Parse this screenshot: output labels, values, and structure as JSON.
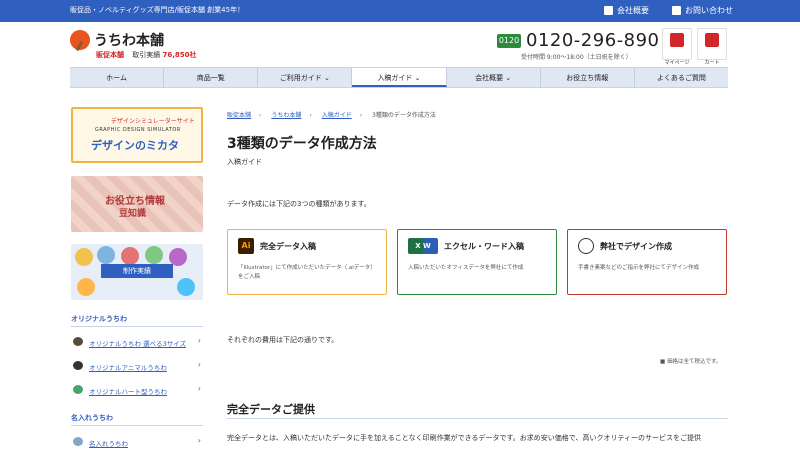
{
  "topbar": {
    "tagline": "販促品・ノベルティグッズ専門店/販促本舗 創業45年！",
    "company_link": "会社概要",
    "contact_link": "お問い合わせ"
  },
  "header": {
    "logo_title": "うちわ本舗",
    "logo_brand": "販促本舗",
    "logo_record_label": "取引実績",
    "logo_record_count": "76,850社",
    "phone_label": "0120",
    "phone_number": "0120-296-890",
    "hours": "受付時間 9:00～18:00（土日祝を除く）",
    "mypage_label": "マイページ",
    "cart_label": "カート"
  },
  "nav": {
    "items": [
      {
        "label": "ホーム"
      },
      {
        "label": "商品一覧"
      },
      {
        "label": "ご利用ガイド ⌄"
      },
      {
        "label": "入稿ガイド ⌄"
      },
      {
        "label": "会社概要 ⌄"
      },
      {
        "label": "お役立ち情報"
      },
      {
        "label": "よくあるご質問"
      }
    ]
  },
  "sidebar": {
    "banner1": {
      "line1": "デザインシミュレーターサイト",
      "line2": "GRAPHIC DESIGN SIMULATOR",
      "line3": "デザインのミカタ"
    },
    "banner2": {
      "line1": "お役立ち情報",
      "line2": "豆知識"
    },
    "banner3": {
      "label": "制作実績"
    },
    "section1_title": "オリジナルうちわ",
    "section1_links": [
      {
        "label": "オリジナルうちわ 選べる3サイズ"
      },
      {
        "label": "オリジナルアニマルうちわ"
      },
      {
        "label": "オリジナルハート型うちわ"
      }
    ],
    "section2_title": "名入れうちわ",
    "section2_links": [
      {
        "label": "名入れうちわ"
      }
    ]
  },
  "main": {
    "breadcrumb": [
      "販促本舗",
      "うちわ本舗",
      "入稿ガイド",
      "3種類のデータ作成方法"
    ],
    "title": "3種類のデータ作成方法",
    "subtitle": "入稿ガイド",
    "intro": "データ作成には下記の3つの種類があります。",
    "cards": [
      {
        "icon_text": "Ai",
        "name": "完全データ入稿",
        "desc": "「Illustrator」にて作成いただいたデータ（.aiデータ）をご入稿",
        "color": "#f0b440"
      },
      {
        "icon_text": "X W",
        "name": "エクセル・ワード入稿",
        "desc": "入稿いただいたオフィスデータを弊社にて作成",
        "color": "#2c8a3c"
      },
      {
        "icon_text": "",
        "name": "弊社でデザイン作成",
        "desc": "手書き素案などのご指示を弊社にてデザイン作成",
        "color": "#c0392b"
      }
    ],
    "cost_text": "それぞれの費用は下記の通りです。",
    "tax_note": "価格は全て税込です。",
    "section_title": "完全データご提供",
    "section_para": "完全データとは、入稿いただいたデータに手を加えることなく印刷作業ができるデータです。お求め安い価格で、高いクオリティーのサービスをご提供",
    "colors": {
      "primary": "#2f5fbf",
      "accent": "#d2262a"
    }
  }
}
